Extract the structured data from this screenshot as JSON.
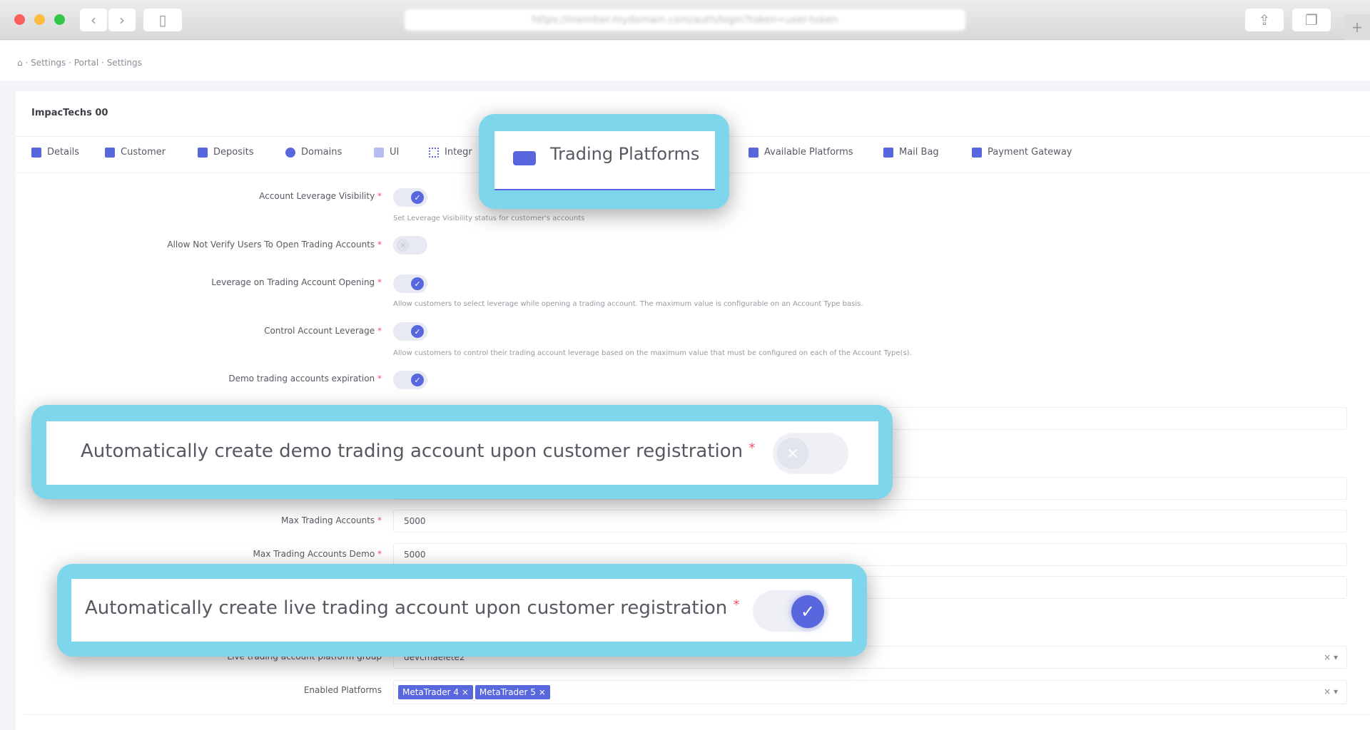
{
  "browser": {
    "url": "https://member.mydomain.com/auth/login?token=user-token",
    "back": "‹",
    "forward": "›",
    "new_tab": "+"
  },
  "breadcrumb": [
    "Settings",
    "Portal",
    "Settings"
  ],
  "card_title": "ImpacTechs 00",
  "tabs": [
    {
      "label": "Details"
    },
    {
      "label": "Customer"
    },
    {
      "label": "Deposits"
    },
    {
      "label": "Domains"
    },
    {
      "label": "UI"
    },
    {
      "label": "Integr"
    },
    {
      "label": "Trading Platforms",
      "active": true
    },
    {
      "label": "Available Platforms"
    },
    {
      "label": "Mail Bag"
    },
    {
      "label": "Payment Gateway"
    }
  ],
  "form": {
    "account_leverage_visibility": {
      "label": "Account Leverage Visibility",
      "on": true,
      "help": "Set Leverage Visibility status for customer's accounts"
    },
    "allow_not_verify": {
      "label": "Allow Not Verify Users To Open Trading Accounts",
      "on": false
    },
    "leverage_on_opening": {
      "label": "Leverage on Trading Account Opening",
      "on": true,
      "help": "Allow customers to select leverage while opening a trading account. The maximum value is configurable on an Account Type basis."
    },
    "control_leverage": {
      "label": "Control Account Leverage",
      "on": true,
      "help": "Allow customers to control their trading account leverage based on the maximum value that must be configured on each of the Account Type(s)."
    },
    "demo_expiration": {
      "label": "Demo trading accounts expiration",
      "on": true
    },
    "max_trading_accounts": {
      "label": "Max Trading Accounts",
      "value": "5000"
    },
    "max_trading_accounts_demo": {
      "label": "Max Trading Accounts Demo",
      "value": "5000"
    },
    "live_platform_group": {
      "label": "Live trading account platform group",
      "value": "devcmaelete2"
    },
    "enabled_platforms": {
      "label": "Enabled Platforms",
      "chips": [
        "MetaTrader 4 ×",
        "MetaTrader 5 ×"
      ]
    },
    "clear": "×",
    "caret": "▾",
    "required": "*"
  },
  "callouts": {
    "tab": "Trading Platforms",
    "demo": "Automatically create demo trading account upon customer registration",
    "demo_on": false,
    "live": "Automatically create live trading account upon customer registration",
    "live_on": true
  },
  "colors": {
    "accent": "#5867dd",
    "callout": "#7dd6ec",
    "required": "#f4516c"
  }
}
